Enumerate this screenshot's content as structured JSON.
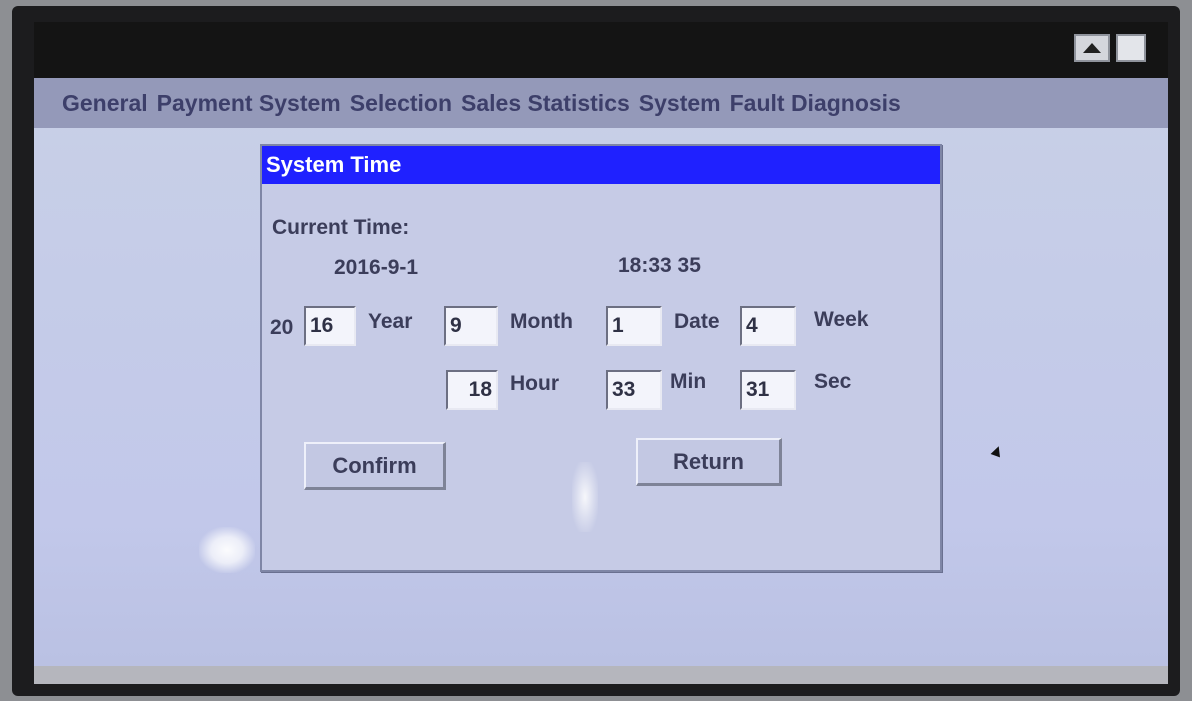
{
  "menu": {
    "items": [
      {
        "label": "General"
      },
      {
        "label": "Payment System"
      },
      {
        "label": "Selection"
      },
      {
        "label": "Sales Statistics"
      },
      {
        "label": "System"
      },
      {
        "label": "Fault Diagnosis"
      }
    ]
  },
  "dialog": {
    "title": "System Time",
    "current_time_label": "Current Time:",
    "current_date": "2016-9-1",
    "current_clock": "18:33 35",
    "year_prefix": "20",
    "year_value": "16",
    "year_label": "Year",
    "month_value": "9",
    "month_label": "Month",
    "date_value": "1",
    "date_label": "Date",
    "week_value": "4",
    "week_label": "Week",
    "hour_value": "18",
    "hour_label": "Hour",
    "min_value": "33",
    "min_label": "Min",
    "sec_value": "31",
    "sec_label": "Sec",
    "confirm_label": "Confirm",
    "return_label": "Return"
  },
  "colors": {
    "title_bar": "#1f21ff",
    "menu_bar": "#9499b9",
    "dialog_bg": "#c6cbe6",
    "screen_bg": "#c5cce8"
  },
  "icons": {
    "scroll_up": "triangle-up-icon",
    "scroll_box": "square-icon"
  }
}
